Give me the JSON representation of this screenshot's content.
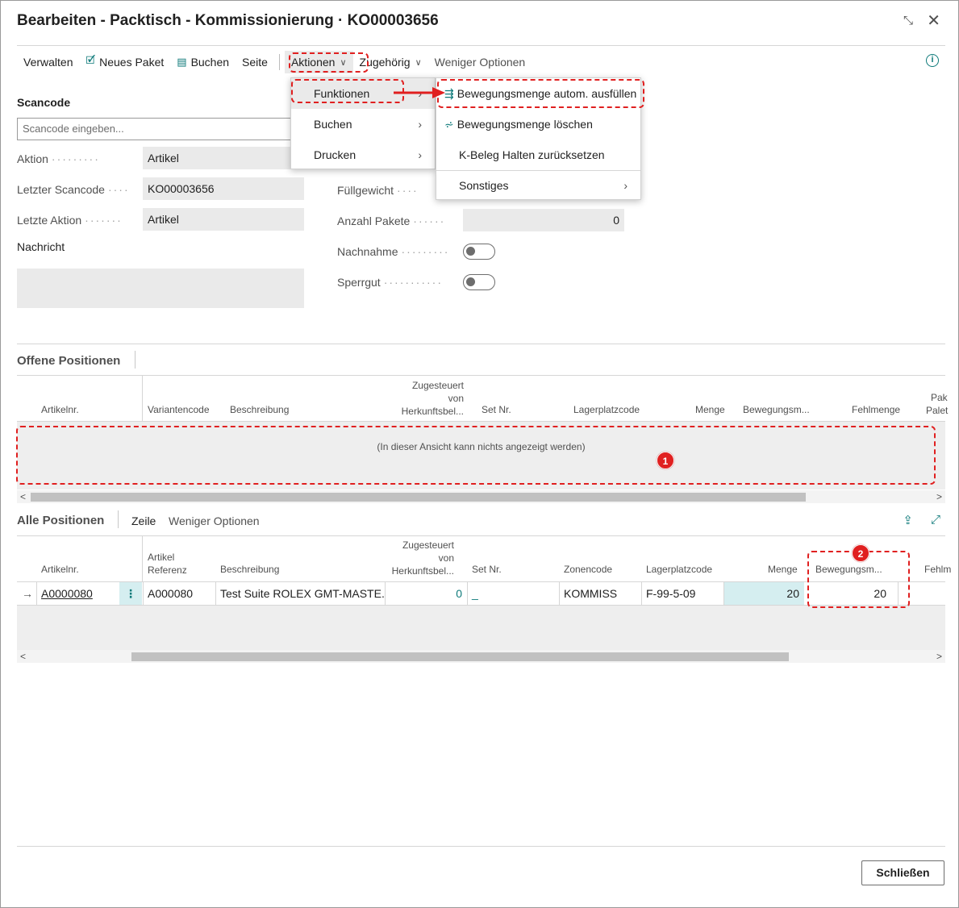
{
  "window": {
    "title": "Bearbeiten - Packtisch - Kommissionierung · KO00003656"
  },
  "toolbar": {
    "verwalten": "Verwalten",
    "neues_paket": "Neues Paket",
    "buchen": "Buchen",
    "seite": "Seite",
    "aktionen": "Aktionen",
    "zugehoerig": "Zugehörig",
    "weniger_optionen": "Weniger Optionen"
  },
  "form": {
    "scancode_heading": "Scancode",
    "scancode_placeholder": "Scancode eingeben...",
    "aktion_label": "Aktion",
    "aktion_value": "Artikel",
    "letzter_scancode_label": "Letzter Scancode",
    "letzter_scancode_value": "KO00003656",
    "letzte_aktion_label": "Letzte Aktion",
    "letzte_aktion_value": "Artikel",
    "nachricht_label": "Nachricht",
    "fuellgewicht_label": "Füllgewicht",
    "anzahl_pakete_label": "Anzahl Pakete",
    "anzahl_pakete_value": "0",
    "nachnahme_label": "Nachnahme",
    "sperrgut_label": "Sperrgut"
  },
  "aktionen_menu": {
    "items": [
      "Funktionen",
      "Buchen",
      "Drucken"
    ]
  },
  "funktionen_menu": {
    "items": [
      "Bewegungsmenge autom. ausfüllen",
      "Bewegungsmenge löschen",
      "K-Beleg Halten zurücksetzen",
      "Sonstiges"
    ]
  },
  "offene_positionen": {
    "title": "Offene Positionen",
    "columns": [
      "Artikelnr.",
      "Variantencode",
      "Beschreibung",
      "Zugesteuert",
      "von",
      "Herkunftsbel...",
      "Set Nr.",
      "Lagerplatzcode",
      "Menge",
      "Bewegungsm...",
      "Fehlmenge",
      "Pak",
      "Palet"
    ],
    "empty_text": "(In dieser Ansicht kann nichts angezeigt werden)"
  },
  "alle_positionen": {
    "title": "Alle Positionen",
    "zeile": "Zeile",
    "weniger_optionen": "Weniger Optionen",
    "columns": [
      "Artikelnr.",
      "Artikel",
      "Referenz",
      "Beschreibung",
      "Zugesteuert",
      "von",
      "Herkunftsbel...",
      "Set Nr.",
      "Zonencode",
      "Lagerplatzcode",
      "Menge",
      "Bewegungsm...",
      "Fehlm"
    ],
    "row": {
      "artikelnr": "A0000080",
      "referenz": "A000080",
      "beschreibung": "Test Suite ROLEX GMT-MASTE...",
      "zugesteuert": "0",
      "set_nr": "_",
      "zonencode": "KOMMISS",
      "lagerplatzcode": "F-99-5-09",
      "menge": "20",
      "bewegungsmenge": "20"
    }
  },
  "badges": [
    "1",
    "2"
  ],
  "footer": {
    "close": "Schließen"
  },
  "colors": {
    "accent": "#0e7a7a",
    "annotation": "#e02020",
    "highlight_cell": "#d5eef0"
  }
}
